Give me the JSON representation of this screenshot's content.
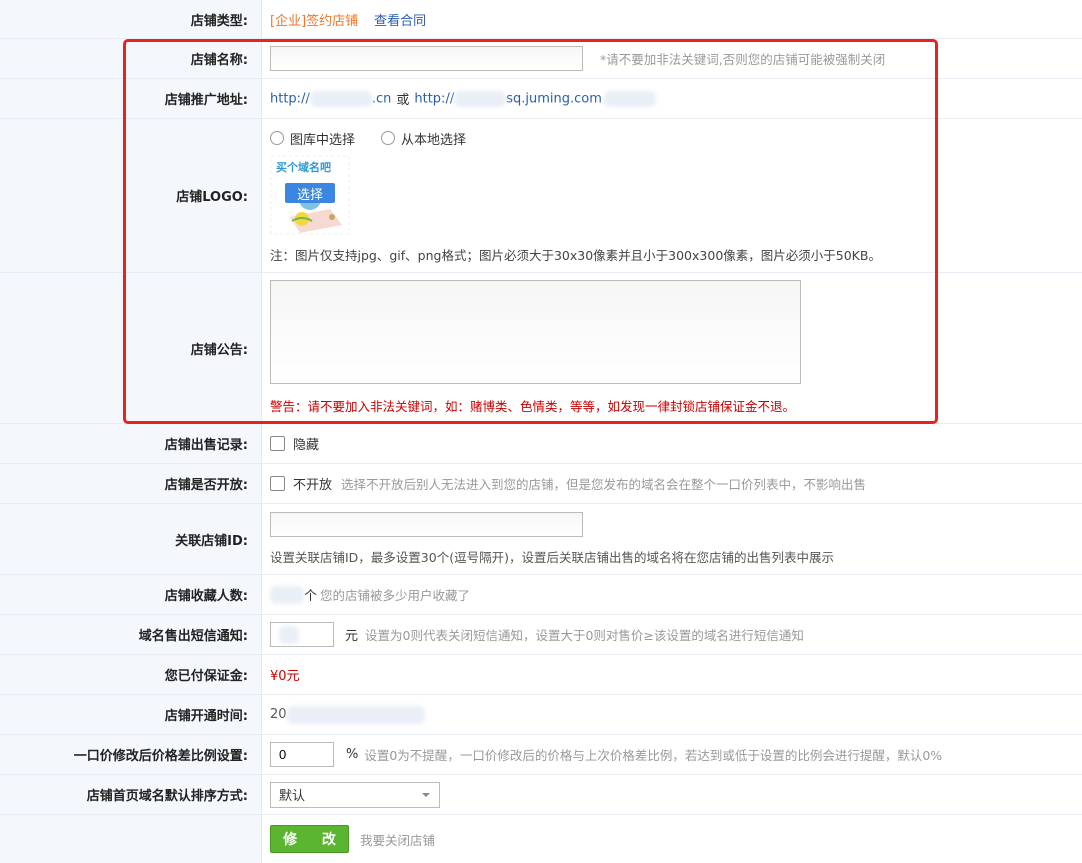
{
  "shop_type": {
    "label": "店铺类型:",
    "value": "[企业]签约店铺",
    "link": "查看合同"
  },
  "shop_name": {
    "label": "店铺名称:",
    "hint": "*请不要加非法关键词,否则您的店铺可能被强制关闭"
  },
  "shop_url": {
    "label": "店铺推广地址:",
    "url1_prefix": "http://",
    "url1_suffix": ".cn",
    "or": "或",
    "url2_prefix": "http://",
    "url2_suffix": "sq.juming.com"
  },
  "shop_logo": {
    "label": "店铺LOGO:",
    "opt_gallery": "图库中选择",
    "opt_local": "从本地选择",
    "logo_text": "买个域名吧",
    "choose": "选择",
    "note": "注：图片仅支持jpg、gif、png格式；图片必须大于30x30像素并且小于300x300像素，图片必须小于50KB。"
  },
  "shop_notice": {
    "label": "店铺公告:",
    "warning": "警告：请不要加入非法关键词，如：赌博类、色情类，等等，如发现一律封锁店铺保证金不退。"
  },
  "sale_record": {
    "label": "店铺出售记录:",
    "option": "隐藏"
  },
  "shop_open": {
    "label": "店铺是否开放:",
    "option": "不开放",
    "hint": "选择不开放后别人无法进入到您的店铺，但是您发布的域名会在整个一口价列表中，不影响出售"
  },
  "linked_id": {
    "label": "关联店铺ID:",
    "hint": "设置关联店铺ID，最多设置30个(逗号隔开)，设置后关联店铺出售的域名将在您店铺的出售列表中展示"
  },
  "favorites": {
    "label": "店铺收藏人数:",
    "unit": "个",
    "hint": "您的店铺被多少用户收藏了"
  },
  "sms_notice": {
    "label": "域名售出短信通知:",
    "unit": "元",
    "hint": "设置为0则代表关闭短信通知，设置大于0则对售价≥该设置的域名进行短信通知"
  },
  "deposit": {
    "label": "您已付保证金:",
    "value": "¥0元"
  },
  "open_time": {
    "label": "店铺开通时间:",
    "value": "20"
  },
  "price_ratio": {
    "label": "一口价修改后价格差比例设置:",
    "value": "0",
    "unit": "%",
    "hint": "设置0为不提醒，一口价修改后的价格与上次价格差比例，若达到或低于设置的比例会进行提醒，默认0%"
  },
  "sort_mode": {
    "label": "店铺首页域名默认排序方式:",
    "value": "默认"
  },
  "actions": {
    "submit": "修 改",
    "close_shop": "我要关闭店铺"
  },
  "colors": {
    "orange": "#f0762b",
    "link": "#2a5db0",
    "warning": "#cc0000",
    "highlight_border": "#e8221d",
    "button": "#5cb531"
  }
}
